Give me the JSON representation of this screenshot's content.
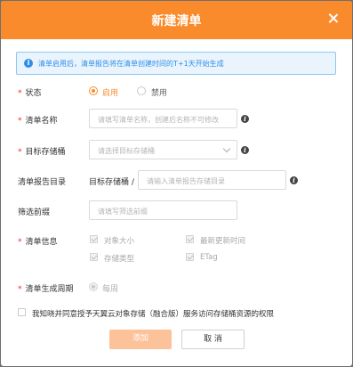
{
  "dialog": {
    "title": "新建清单",
    "close_icon": "close-icon"
  },
  "notice": {
    "icon": "info-icon",
    "text": "清单启用后，清单报告将在清单创建时间的T+1天开始生成",
    "color": "#2e8ee8"
  },
  "form": {
    "status": {
      "label": "状态",
      "options": [
        "启用",
        "禁用"
      ],
      "selected": "启用"
    },
    "name": {
      "label": "清单名称",
      "placeholder": "请填写清单名称，创建后名称不可修改"
    },
    "target_bucket": {
      "label": "目标存储桶",
      "placeholder": "请选择目标存储桶"
    },
    "report_dir": {
      "label": "清单报告目录",
      "prefix": "目标存储桶 /",
      "placeholder": "请输入清单报告存储目录"
    },
    "filter_prefix": {
      "label": "筛选前缀",
      "placeholder": "请填写筛选前缀"
    },
    "info": {
      "label": "清单信息",
      "items": [
        "对象大小",
        "最新更新时间",
        "存储类型",
        "ETag"
      ]
    },
    "period": {
      "label": "清单生成周期",
      "option": "每周"
    },
    "agreement": "我知晓并同意授予天翼云对象存储（融合版）服务访问存储桶资源的权限"
  },
  "buttons": {
    "submit": "添加",
    "cancel": "取 消"
  },
  "colors": {
    "accent": "#fa8b2c",
    "required": "#f5222d"
  }
}
